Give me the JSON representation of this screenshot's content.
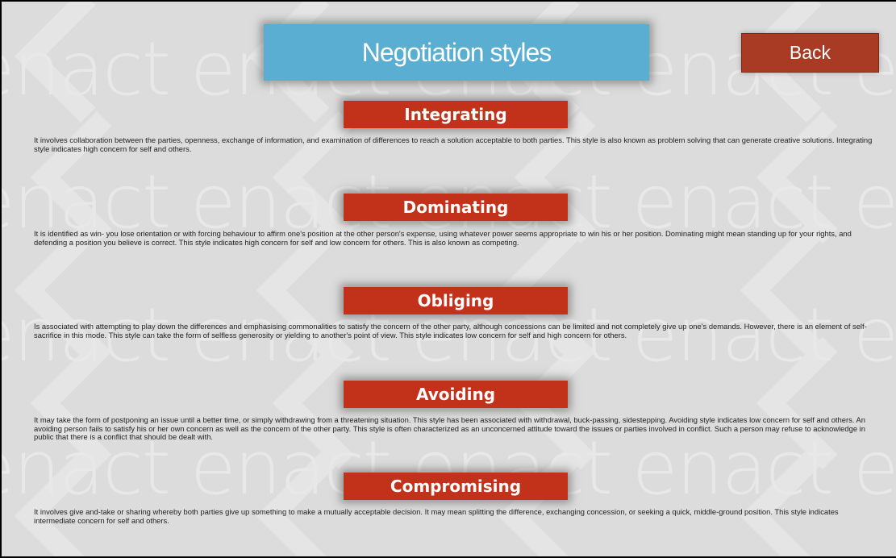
{
  "header": {
    "title": "Negotiation styles",
    "back_label": "Back"
  },
  "background": {
    "watermark_word": "enact"
  },
  "styles": [
    {
      "name": "Integrating",
      "description": "It involves collaboration between the parties, openness, exchange of information, and examination of differences to reach a solution acceptable to both parties. This style is also known as problem solving that can generate creative solutions. Integrating  style indicates high concern for self and others."
    },
    {
      "name": "Dominating",
      "description": "It is identified as win- you lose orientation or with forcing behaviour to affirm one's position at the other person's expense, using whatever power seems appropriate to win his or her position. Dominating might mean standing up for your rights, and defending a position you believe is correct. This style indicates high concern for self and low concern for others. This is also known as competing."
    },
    {
      "name": "Obliging",
      "description": "Is associated with attempting to play down the differences and emphasising commonalities to satisfy the concern of the other party, although concessions can be limited and not completely give up one's demands.   However, there is an element of self-sacrifice in this mode. This style can take the form of selfless generosity or yielding to another's point of view. This style indicates low concern for self and high concern for others."
    },
    {
      "name": "Avoiding",
      "description": "It may take the form of postponing an issue until a better time, or simply withdrawing from a threatening situation. This style has been associated with withdrawal, buck-passing, sidestepping. Avoiding style indicates low concern for self and others. An avoiding person fails to satisfy his or her own concern as well as the concern of the other party. This style is often characterized as an unconcerned attitude toward the issues or parties involved in conflict. Such a person may refuse to acknowledge in public that there is a conflict that should be dealt with."
    },
    {
      "name": "Compromising",
      "description": "It involves give and-take or sharing whereby both parties give up something to make a mutually acceptable decision. It may mean splitting the difference, exchanging concession, or seeking a quick, middle-ground position. This style indicates intermediate concern for self and others."
    }
  ],
  "colors": {
    "title_bg": "#5aaed2",
    "section_header_bg": "#c2321a",
    "back_button_bg": "#a93b24",
    "page_bg": "#dcdcdc"
  }
}
